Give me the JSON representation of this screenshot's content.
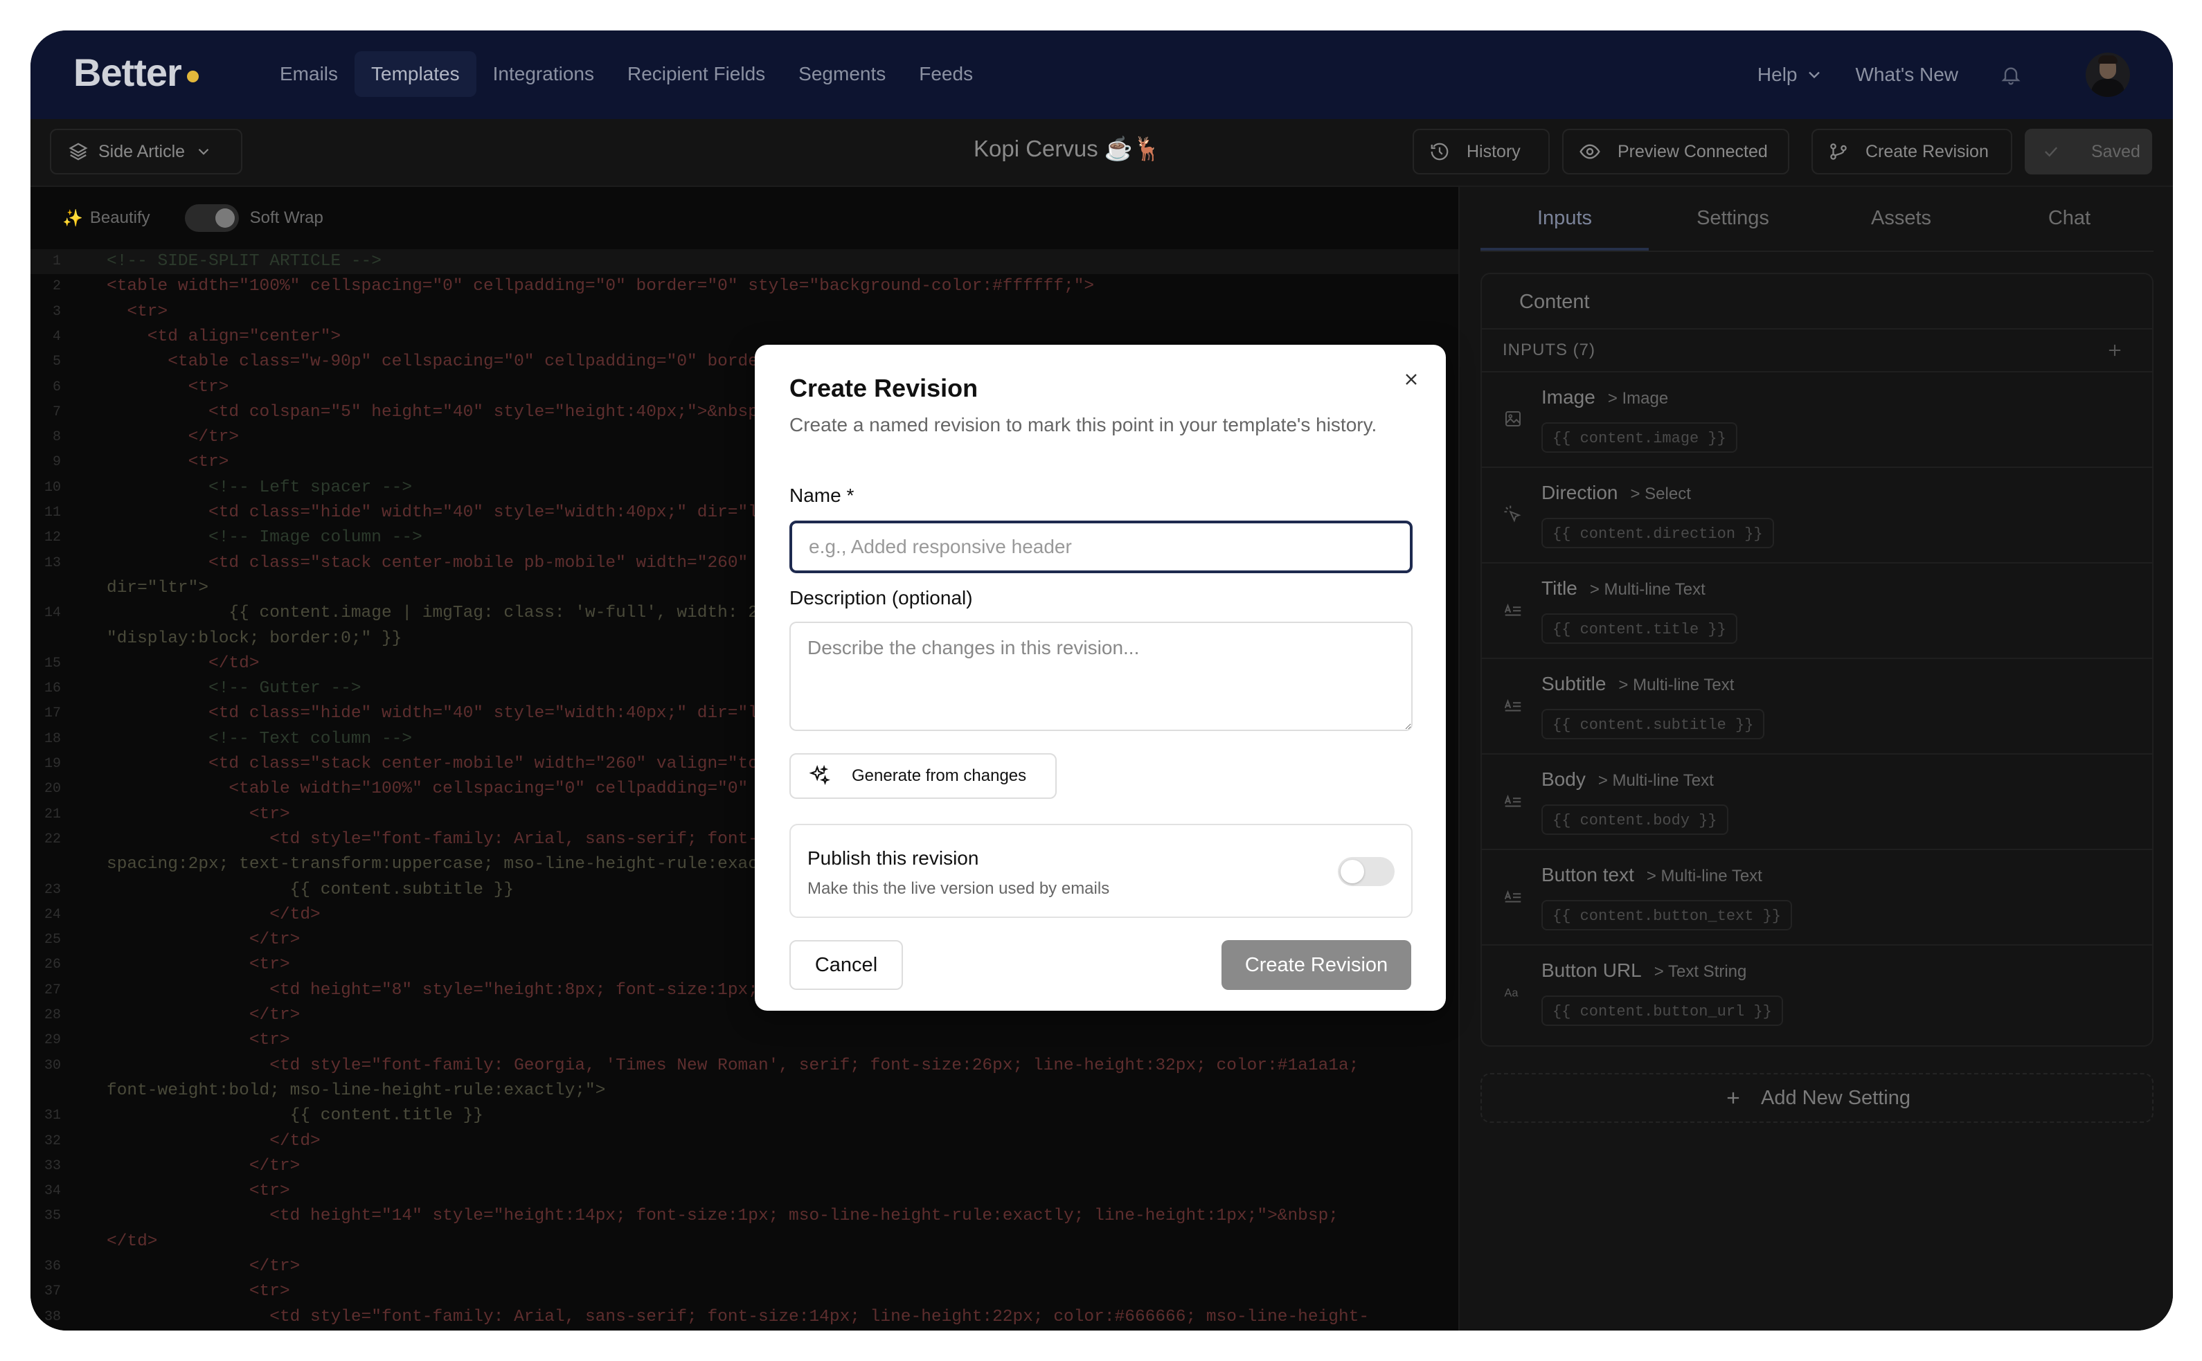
{
  "app": {
    "logo": "Better"
  },
  "nav": {
    "links": [
      "Emails",
      "Templates",
      "Integrations",
      "Recipient Fields",
      "Segments",
      "Feeds"
    ],
    "help": "Help",
    "whats_new": "What's New"
  },
  "toolbar": {
    "template_select": "Side Article",
    "doc_title": "Kopi Cervus ☕🦌",
    "history": "History",
    "preview": "Preview Connected",
    "create_revision": "Create Revision",
    "saved": "Saved"
  },
  "editor": {
    "beautify": "Beautify",
    "soft_wrap": "Soft Wrap",
    "lines": [
      {
        "n": "1",
        "text": "<!-- SIDE-SPLIT ARTICLE -->"
      },
      {
        "n": "2",
        "text": "<table width=\"100%\" cellspacing=\"0\" cellpadding=\"0\" border=\"0\" style=\"background-color:#ffffff;\">"
      },
      {
        "n": "3",
        "text": "  <tr>"
      },
      {
        "n": "4",
        "text": "    <td align=\"center\">"
      },
      {
        "n": "5",
        "text": "      <table class=\"w-90p\" cellspacing=\"0\" cellpadding=\"0\" border=\"0\" width=\"600\">"
      },
      {
        "n": "6",
        "text": "        <tr>"
      },
      {
        "n": "7",
        "text": "          <td colspan=\"5\" height=\"40\" style=\"height:40px;\">&nbsp;</td>"
      },
      {
        "n": "8",
        "text": "        </tr>"
      },
      {
        "n": "9",
        "text": "        <tr>"
      },
      {
        "n": "10",
        "text": "          <!-- Left spacer -->"
      },
      {
        "n": "11",
        "text": "          <td class=\"hide\" width=\"40\" style=\"width:40px;\" dir=\"ltr\">&nbsp;</td>"
      },
      {
        "n": "12",
        "text": "          <!-- Image column -->"
      },
      {
        "n": "13",
        "text": "          <td class=\"stack center-mobile pb-mobile\" width=\"260\" valign=\"top\""
      },
      {
        "n": "",
        "text": "dir=\"ltr\">"
      },
      {
        "n": "14",
        "text": "            {{ content.image | imgTag: class: 'w-full', width: 260, style:"
      },
      {
        "n": "",
        "text": "\"display:block; border:0;\" }}"
      },
      {
        "n": "15",
        "text": "          </td>"
      },
      {
        "n": "16",
        "text": "          <!-- Gutter -->"
      },
      {
        "n": "17",
        "text": "          <td class=\"hide\" width=\"40\" style=\"width:40px;\" dir=\"ltr\">&nbsp;</td>"
      },
      {
        "n": "18",
        "text": "          <!-- Text column -->"
      },
      {
        "n": "19",
        "text": "          <td class=\"stack center-mobile\" width=\"260\" valign=\"top\" dir=\"ltr\">"
      },
      {
        "n": "20",
        "text": "            <table width=\"100%\" cellspacing=\"0\" cellpadding=\"0\" border=\"0\">"
      },
      {
        "n": "21",
        "text": "              <tr>"
      },
      {
        "n": "22",
        "text": "                <td style=\"font-family: Arial, sans-serif; font-size:12px; letter-"
      },
      {
        "n": "",
        "text": "spacing:2px; text-transform:uppercase; mso-line-height-rule:exactly;\">"
      },
      {
        "n": "23",
        "text": "                  {{ content.subtitle }}"
      },
      {
        "n": "24",
        "text": "                </td>"
      },
      {
        "n": "25",
        "text": "              </tr>"
      },
      {
        "n": "26",
        "text": "              <tr>"
      },
      {
        "n": "27",
        "text": "                <td height=\"8\" style=\"height:8px; font-size:1px;\">&nbsp;</td>"
      },
      {
        "n": "28",
        "text": "              </tr>"
      },
      {
        "n": "29",
        "text": "              <tr>"
      },
      {
        "n": "30",
        "text": "                <td style=\"font-family: Georgia, 'Times New Roman', serif; font-size:26px; line-height:32px; color:#1a1a1a;"
      },
      {
        "n": "",
        "text": "font-weight:bold; mso-line-height-rule:exactly;\">"
      },
      {
        "n": "31",
        "text": "                  {{ content.title }}"
      },
      {
        "n": "32",
        "text": "                </td>"
      },
      {
        "n": "33",
        "text": "              </tr>"
      },
      {
        "n": "34",
        "text": "              <tr>"
      },
      {
        "n": "35",
        "text": "                <td height=\"14\" style=\"height:14px; font-size:1px; mso-line-height-rule:exactly; line-height:1px;\">&nbsp;"
      },
      {
        "n": "",
        "text": "</td>"
      },
      {
        "n": "36",
        "text": "              </tr>"
      },
      {
        "n": "37",
        "text": "              <tr>"
      },
      {
        "n": "38",
        "text": "                <td style=\"font-family: Arial, sans-serif; font-size:14px; line-height:22px; color:#666666; mso-line-height-"
      }
    ]
  },
  "panel": {
    "tabs": [
      "Inputs",
      "Settings",
      "Assets",
      "Chat"
    ],
    "content_title": "Content",
    "inputs_header": "INPUTS (7)",
    "inputs": [
      {
        "name": "Image",
        "type": "> Image",
        "tag": "{{ content.image }}",
        "icon": "image-icon"
      },
      {
        "name": "Direction",
        "type": "> Select",
        "tag": "{{ content.direction }}",
        "icon": "pointer-icon"
      },
      {
        "name": "Title",
        "type": "> Multi-line Text",
        "tag": "{{ content.title }}",
        "icon": "text-icon"
      },
      {
        "name": "Subtitle",
        "type": "> Multi-line Text",
        "tag": "{{ content.subtitle }}",
        "icon": "text-icon"
      },
      {
        "name": "Body",
        "type": "> Multi-line Text",
        "tag": "{{ content.body }}",
        "icon": "text-icon"
      },
      {
        "name": "Button text",
        "type": "> Multi-line Text",
        "tag": "{{ content.button_text }}",
        "icon": "text-icon"
      },
      {
        "name": "Button URL",
        "type": "> Text String",
        "tag": "{{ content.button_url }}",
        "icon": "aa-icon"
      }
    ],
    "add_setting": "Add New Setting"
  },
  "modal": {
    "title": "Create Revision",
    "description": "Create a named revision to mark this point in your template's history.",
    "name_label": "Name *",
    "name_placeholder": "e.g., Added responsive header",
    "desc_label": "Description (optional)",
    "desc_placeholder": "Describe the changes in this revision...",
    "generate": "Generate from changes",
    "publish_title": "Publish this revision",
    "publish_sub": "Make this the live version used by emails",
    "publish_on": false,
    "cancel": "Cancel",
    "create": "Create Revision"
  }
}
